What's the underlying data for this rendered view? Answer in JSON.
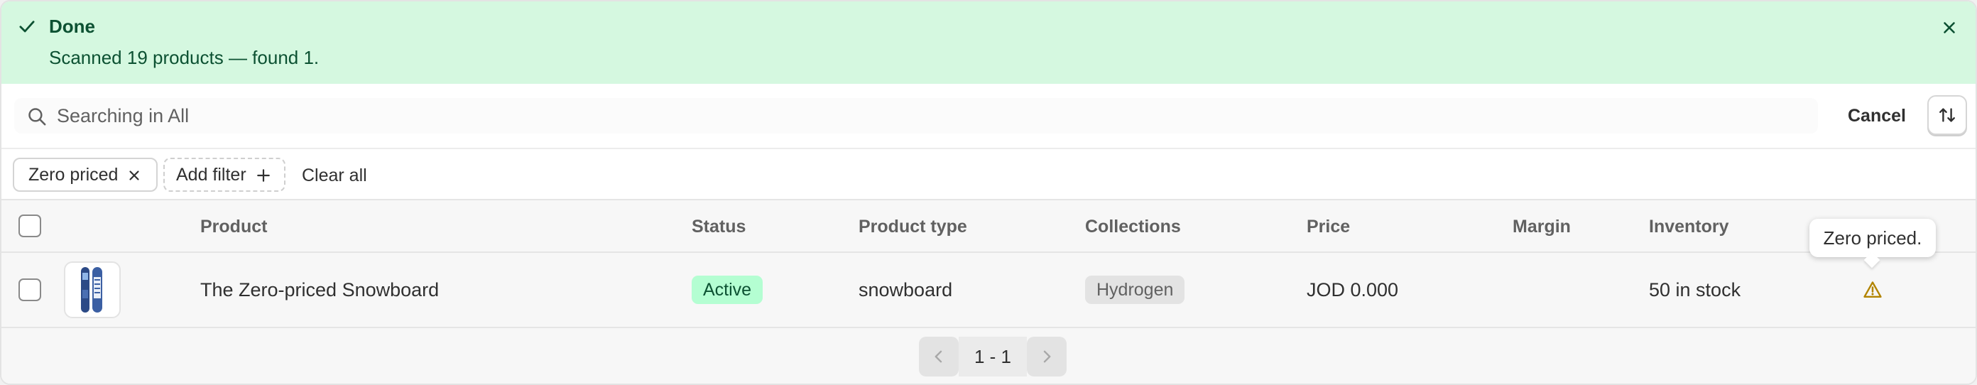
{
  "banner": {
    "title": "Done",
    "message": "Scanned 19 products — found 1.",
    "icons": {
      "status": "checkmark-icon",
      "dismiss": "close-icon"
    },
    "color": "#d5f8e0"
  },
  "search": {
    "placeholder": "Searching in All",
    "value": "",
    "cancel_label": "Cancel",
    "icons": {
      "search": "search-icon",
      "sort": "sort-icon"
    }
  },
  "filters": {
    "applied": [
      {
        "label": "Zero priced"
      }
    ],
    "add_label": "Add filter",
    "clear_label": "Clear all"
  },
  "table": {
    "columns": {
      "product": "Product",
      "status": "Status",
      "product_type": "Product type",
      "collections": "Collections",
      "price": "Price",
      "margin": "Margin",
      "inventory": "Inventory"
    },
    "rows": [
      {
        "product": "The Zero-priced Snowboard",
        "status": "Active",
        "product_type": "snowboard",
        "collection": "Hydrogen",
        "price": "JOD 0.000",
        "margin": "",
        "inventory": "50 in stock",
        "warning_icon": "warning-icon",
        "warning_tooltip": "Zero priced."
      }
    ]
  },
  "pagination": {
    "label": "1 - 1",
    "icons": {
      "prev": "chevron-left-icon",
      "next": "chevron-right-icon"
    }
  },
  "colors": {
    "success_bg": "#d5f8e0",
    "success_text": "#0c5132",
    "active_badge": "#b4fed2",
    "warning": "#b28400"
  }
}
